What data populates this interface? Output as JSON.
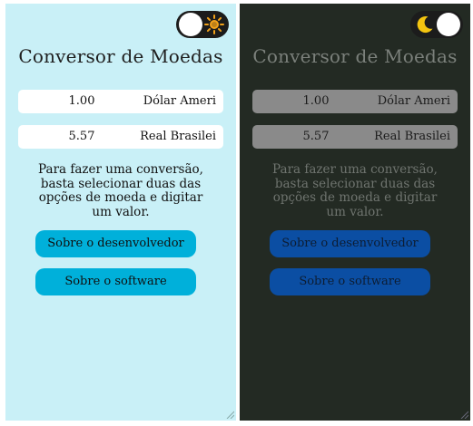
{
  "panels": [
    {
      "theme": "light",
      "toggle_icon": "sun-icon",
      "title": "Conversor de Moedas",
      "from": {
        "amount": "1.00",
        "currency": "Dólar Ameri"
      },
      "to": {
        "amount": "5.57",
        "currency": "Real Brasilei"
      },
      "help_lines": [
        "Para fazer uma conversão,",
        "basta selecionar duas das",
        "opções de moeda e digitar",
        "um valor."
      ],
      "buttons": {
        "developer": "Sobre o desenvolvedor",
        "software": "Sobre o software"
      }
    },
    {
      "theme": "dark",
      "toggle_icon": "moon-icon",
      "title": "Conversor de Moedas",
      "from": {
        "amount": "1.00",
        "currency": "Dólar Ameri"
      },
      "to": {
        "amount": "5.57",
        "currency": "Real Brasilei"
      },
      "help_lines": [
        "Para fazer uma conversão,",
        "basta selecionar duas das",
        "opções de moeda e digitar",
        "um valor."
      ],
      "buttons": {
        "developer": "Sobre o desenvolvedor",
        "software": "Sobre o software"
      }
    }
  ],
  "colors": {
    "light_bg": "#c9f0f7",
    "dark_bg": "#232a23",
    "light_button": "#00b0da",
    "dark_button": "#0b4ea3",
    "sun": "#f2a21a",
    "moon": "#f3c410"
  }
}
